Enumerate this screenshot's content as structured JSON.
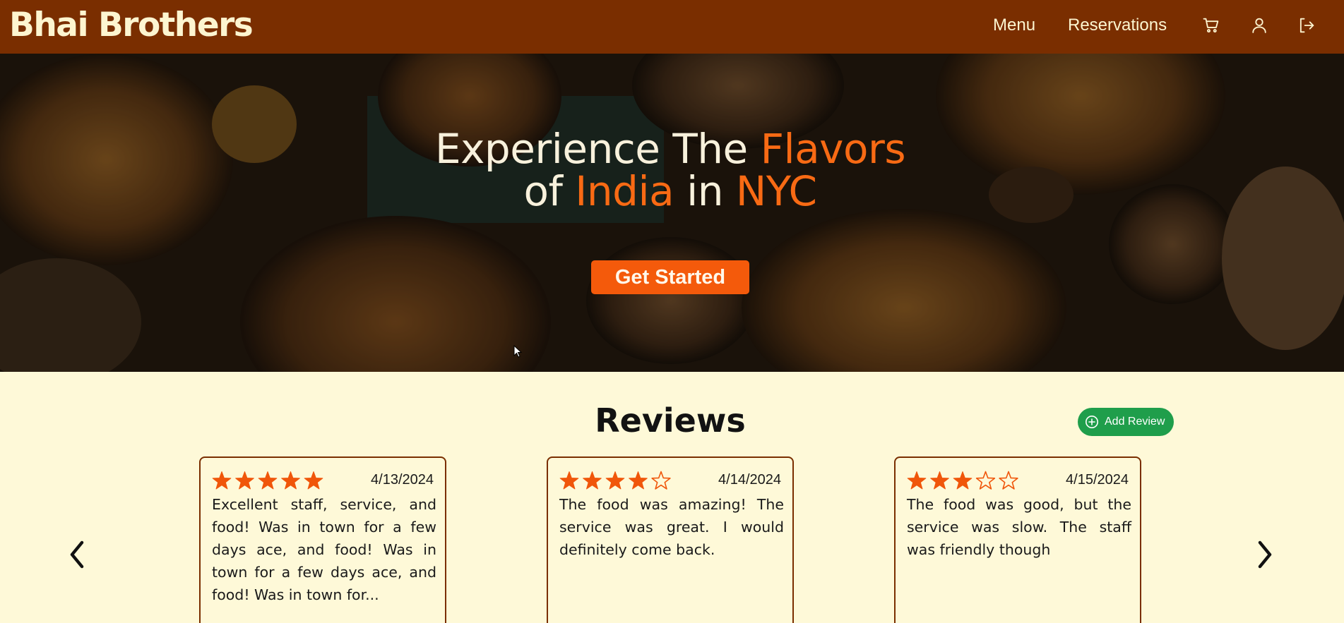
{
  "brand": "Bhai Brothers",
  "nav": {
    "menu_label": "Menu",
    "reservations_label": "Reservations",
    "icons": [
      "cart-icon",
      "user-icon",
      "logout-icon"
    ]
  },
  "hero": {
    "line1_a": "Experience The ",
    "line1_b": "Flavors",
    "line2_a": "of ",
    "line2_b": "India",
    "line2_c": " in ",
    "line2_d": "NYC",
    "cta": "Get Started"
  },
  "reviews": {
    "title": "Reviews",
    "add_label": "Add Review",
    "items": [
      {
        "rating": 5,
        "max": 5,
        "date": "4/13/2024",
        "text": "Excellent staff, service, and food! Was in town for a few days ace, and food! Was in town for a few days ace, and food! Was in town for..."
      },
      {
        "rating": 4,
        "max": 5,
        "date": "4/14/2024",
        "text": "The food was amazing! The service was great. I would definitely come back."
      },
      {
        "rating": 3,
        "max": 5,
        "date": "4/15/2024",
        "text": "The food was good, but the service was slow. The staff was friendly though"
      }
    ]
  },
  "colors": {
    "nav_bg": "#7a2e00",
    "accent": "#f45a0b",
    "star": "#f0560a",
    "add_review_bg": "#1f9e4b",
    "page_bg": "#fef9d8"
  }
}
